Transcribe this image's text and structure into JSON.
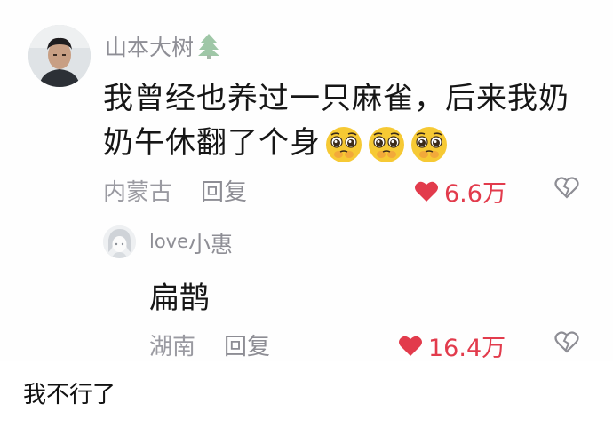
{
  "comment": {
    "username": "山本大树",
    "username_icon": "tree-icon",
    "text": "我曾经也养过一只麻雀，后来我奶奶午休翻了个身",
    "emojis": [
      "pleading-face-icon",
      "pleading-face-icon",
      "pleading-face-icon"
    ],
    "location": "内蒙古",
    "reply_label": "回复",
    "likes": "6.6万"
  },
  "reply": {
    "username_latin": "love",
    "username_cjk": "小惠",
    "text": "扁鹊",
    "location": "湖南",
    "reply_label": "回复",
    "likes": "16.4万"
  },
  "caption": "我不行了",
  "colors": {
    "like_red": "#e23b4c",
    "meta_gray": "#9a9aa1",
    "text_dark": "#161616"
  }
}
